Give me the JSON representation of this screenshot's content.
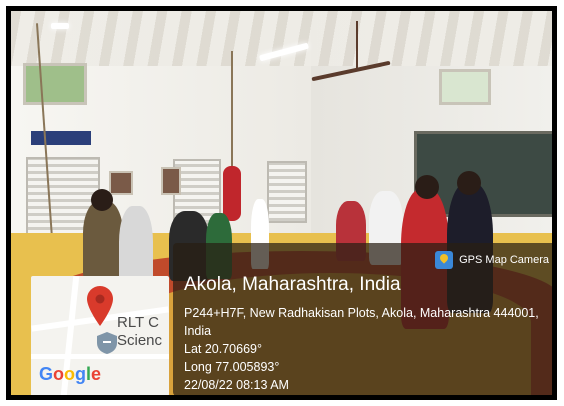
{
  "map": {
    "poi_lines": [
      "RLT C",
      "Scienc"
    ],
    "logo_text": "Google",
    "pin_icon": "map-pin-icon",
    "poi_icon": "shield-icon",
    "colors": {
      "pin": "#d93a2b",
      "poi": "#7f95a8",
      "g_blue": "#4285f4",
      "g_red": "#ea4335",
      "g_yellow": "#fbbc05",
      "g_green": "#34a853"
    }
  },
  "overlay": {
    "app_name": "GPS Map Camera",
    "app_icon": "gps-map-camera-icon",
    "location_title": "Akola, Maharashtra, India",
    "address_line1": "P244+H7F, New Radhakisan Plots, Akola, Maharashtra 444001,",
    "address_line2": "India",
    "latitude": "Lat 20.70669°",
    "longitude": "Long 77.005893°",
    "datetime": "22/08/22 08:13 AM"
  }
}
